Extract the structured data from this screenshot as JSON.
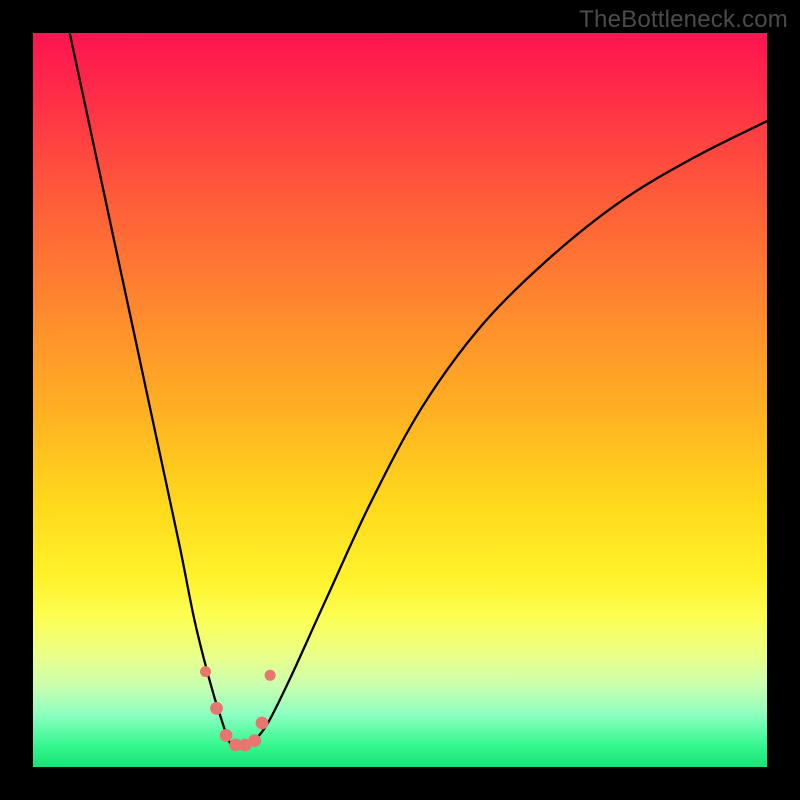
{
  "watermark": "TheBottleneck.com",
  "colors": {
    "frame": "#000000",
    "gradient_top": "#ff1450",
    "gradient_mid": "#ffd81c",
    "gradient_bottom": "#17e576",
    "curve": "#000000",
    "dots": "#e7766e"
  },
  "chart_data": {
    "type": "line",
    "title": "",
    "xlabel": "",
    "ylabel": "",
    "xlim": [
      0,
      100
    ],
    "ylim": [
      0,
      100
    ],
    "series": [
      {
        "name": "bottleneck-curve",
        "x": [
          5,
          8,
          11,
          14,
          17,
          20,
          22,
          24,
          25.5,
          27,
          28.4,
          30,
          32,
          35,
          40,
          46,
          53,
          61,
          70,
          80,
          90,
          100
        ],
        "y": [
          100,
          86,
          72,
          58,
          44,
          30,
          20,
          12,
          7,
          3,
          3,
          3.5,
          6,
          12,
          23,
          36,
          49,
          60,
          69,
          77,
          83,
          88
        ]
      }
    ],
    "markers": {
      "name": "highlight-dots",
      "x": [
        23.5,
        25.0,
        26.3,
        27.6,
        28.9,
        30.2,
        31.2,
        32.3
      ],
      "y": [
        13.0,
        8.0,
        4.3,
        3.0,
        3.0,
        3.6,
        6.0,
        12.5
      ],
      "r": [
        5.5,
        6.4,
        6.4,
        6.4,
        6.4,
        6.4,
        6.4,
        5.5
      ]
    }
  }
}
